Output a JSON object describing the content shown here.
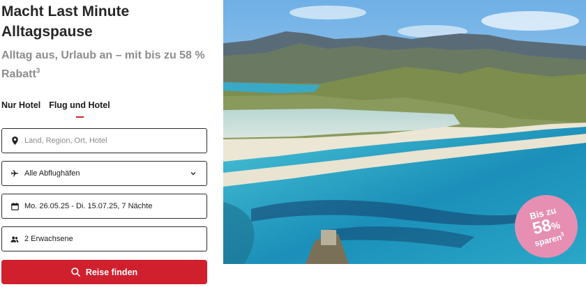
{
  "header": {
    "title": "Macht Last Minute Alltagspause",
    "subtitle": "Alltag aus, Urlaub an – mit bis zu 58 % Rabatt",
    "subtitle_sup": "3"
  },
  "tabs": [
    {
      "label": "Nur Hotel",
      "active": false
    },
    {
      "label": "Flug und Hotel",
      "active": true
    }
  ],
  "search": {
    "destination_placeholder": "Land, Region, Ort, Hotel",
    "departure_value": "Alle Abflughäfen",
    "dates_value": "Mo. 26.05.25 - Di. 15.07.25, 7 Nächte",
    "travellers_value": "2 Erwachsene",
    "submit_label": "Reise finden"
  },
  "icons": {
    "destination": "location-pin-icon",
    "departure": "airplane-icon",
    "departure_toggle": "chevron-down-icon",
    "dates": "calendar-icon",
    "travellers": "people-icon",
    "submit": "search-icon"
  },
  "badge": {
    "line1": "Bis zu",
    "number": "58",
    "unit": "%",
    "line3": "sparen",
    "line3_sup": "3"
  },
  "colors": {
    "accent": "#d0202e",
    "badge": "#e68fb3",
    "subtitle": "#8c8c8c"
  }
}
